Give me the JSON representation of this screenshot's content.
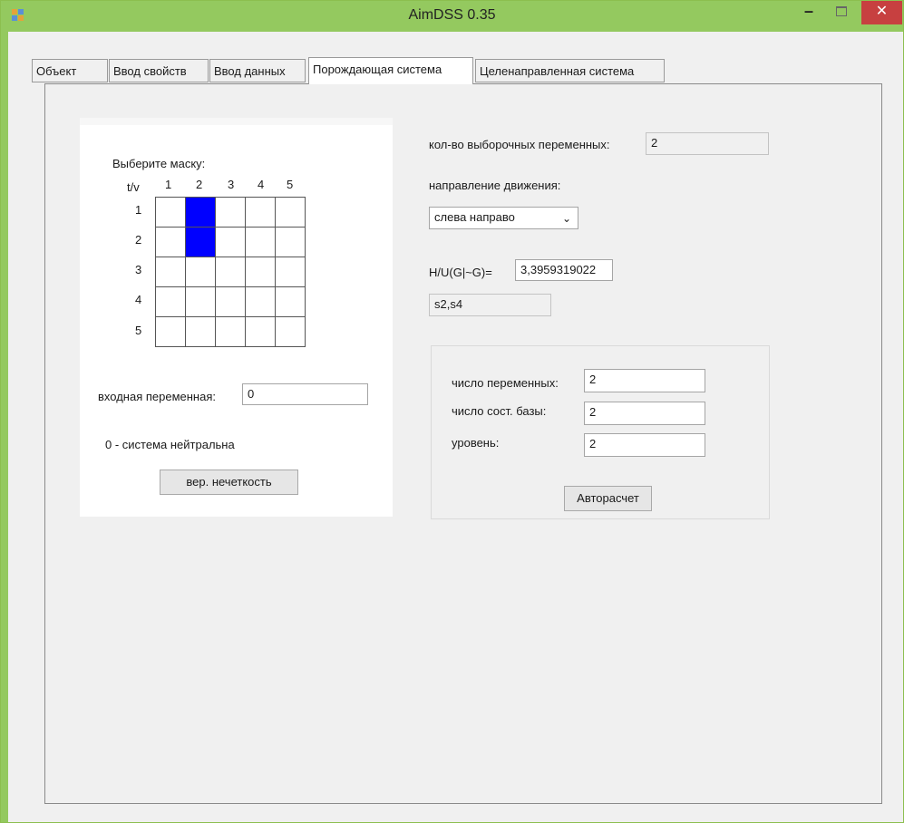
{
  "window": {
    "title": "AimDSS 0.35",
    "min_glyph": "–",
    "close_glyph": "✕"
  },
  "tabs": [
    {
      "label": "Объект"
    },
    {
      "label": "Ввод свойств"
    },
    {
      "label": "Ввод данных"
    },
    {
      "label": "Порождающая система",
      "active": true
    },
    {
      "label": "Целенаправленная система"
    }
  ],
  "mask": {
    "title": "Выберите маску:",
    "corner": "t/v",
    "col_headers": [
      "1",
      "2",
      "3",
      "4",
      "5"
    ],
    "row_headers": [
      "1",
      "2",
      "3",
      "4",
      "5"
    ],
    "cells": [
      [
        0,
        1,
        0,
        0,
        0
      ],
      [
        0,
        1,
        0,
        0,
        0
      ],
      [
        0,
        0,
        0,
        0,
        0
      ],
      [
        0,
        0,
        0,
        0,
        0
      ],
      [
        0,
        0,
        0,
        0,
        0
      ]
    ],
    "selected_color": "#0000ff"
  },
  "input_var": {
    "label": "входная переменная:",
    "value": "0"
  },
  "neutral_text": "0 - система нейтральна",
  "fuzzy_button": "вер. нечеткость",
  "sample_vars": {
    "label": "кол-во выборочных переменных:",
    "value": "2"
  },
  "direction": {
    "label": "направление движения:",
    "value": "слева направо"
  },
  "entropy": {
    "label": "H/U(G|~G)=",
    "value": "3,3959319022"
  },
  "states": {
    "value": "s2,s4"
  },
  "params": {
    "vars": {
      "label": "число переменных:",
      "value": "2"
    },
    "base": {
      "label": "число сост. базы:",
      "value": "2"
    },
    "level": {
      "label": "уровень:",
      "value": "2"
    },
    "auto_button": "Авторасчет"
  },
  "colors": {
    "titlebar": "#94c95f",
    "close": "#c74040"
  }
}
